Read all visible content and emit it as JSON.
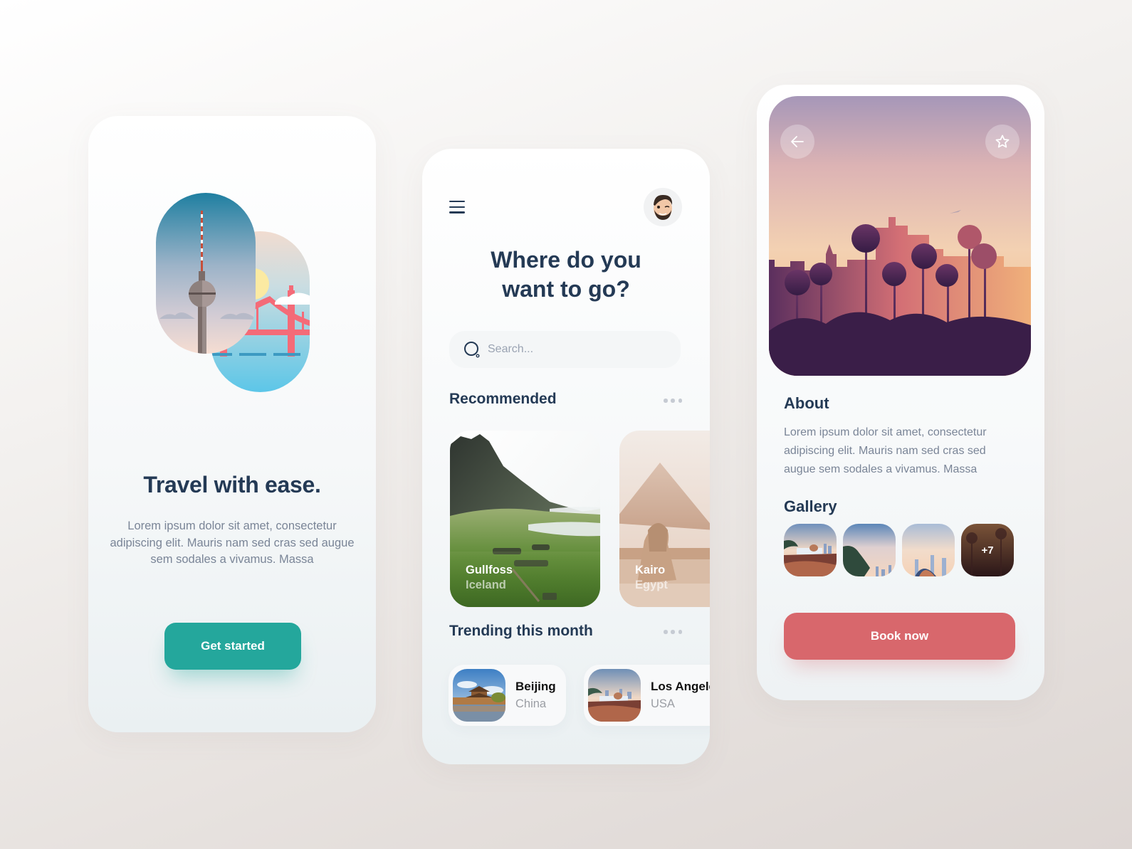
{
  "screens": {
    "onboarding": {
      "illustration": "berlin-tower-and-golden-gate-bridge",
      "title": "Travel with ease.",
      "body": "Lorem ipsum dolor sit amet, consectetur adipiscing elit. Mauris nam sed cras sed augue sem sodales a vivamus. Massa",
      "cta_label": "Get started",
      "cta_color": "#24a79c"
    },
    "home": {
      "menu_icon": "hamburger-menu-icon",
      "avatar_icon": "memoji-avatar",
      "title_line1": "Where do you",
      "title_line2": "want to go?",
      "search": {
        "placeholder": "Search...",
        "value": ""
      },
      "recommended": {
        "heading": "Recommended",
        "more_icon": "more-dots-icon",
        "items": [
          {
            "name": "Gullfoss",
            "country": "Iceland"
          },
          {
            "name": "Kairo",
            "country": "Egypt"
          }
        ]
      },
      "trending": {
        "heading": "Trending this month",
        "more_icon": "more-dots-icon",
        "items": [
          {
            "city": "Beijing",
            "country": "China"
          },
          {
            "city": "Los Angeles",
            "country": "USA"
          }
        ]
      }
    },
    "detail": {
      "back_icon": "arrow-left-icon",
      "favorite_icon": "star-outline-icon",
      "about_heading": "About",
      "about_body": "Lorem ipsum dolor sit amet, consectetur adipiscing elit. Mauris nam sed cras sed augue sem sodales a vivamus. Massa",
      "gallery_heading": "Gallery",
      "gallery_more": "+7",
      "book_label": "Book now",
      "book_color": "#d8676c"
    }
  }
}
